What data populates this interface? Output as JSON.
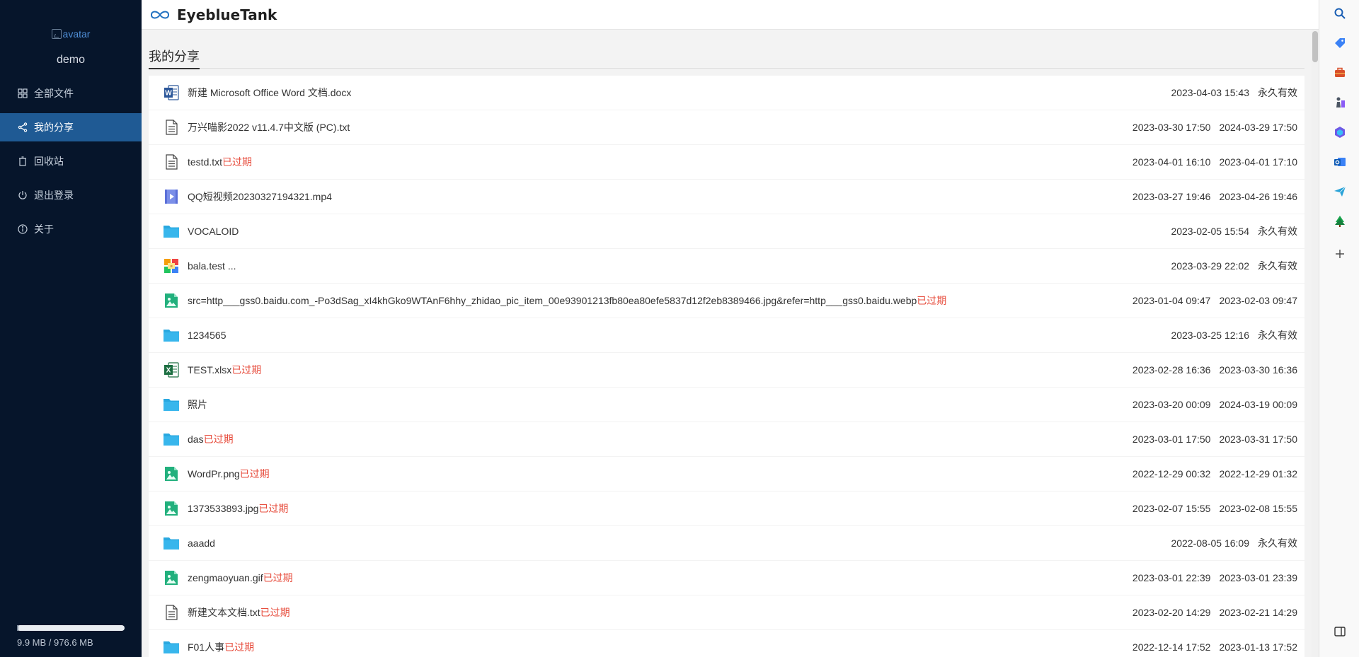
{
  "app": {
    "brand": "EyeblueTank"
  },
  "user": {
    "avatar_alt": "avatar",
    "name": "demo"
  },
  "sidebar": {
    "items": [
      {
        "label": "全部文件",
        "icon": "grid-icon"
      },
      {
        "label": "我的分享",
        "icon": "share-icon",
        "active": true
      },
      {
        "label": "回收站",
        "icon": "trash-icon"
      },
      {
        "label": "退出登录",
        "icon": "power-icon"
      },
      {
        "label": "关于",
        "icon": "info-icon"
      }
    ],
    "storage": {
      "text": "9.9 MB / 976.6 MB",
      "fraction": 0.0101
    }
  },
  "page": {
    "title": "我的分享"
  },
  "shares": [
    {
      "name": "新建 Microsoft Office Word 文档.docx",
      "type": "word",
      "expired": "",
      "created": "2023-04-03 15:43",
      "expire": "永久有效"
    },
    {
      "name": "万兴喵影2022 v11.4.7中文版 (PC).txt",
      "type": "text",
      "expired": "",
      "created": "2023-03-30 17:50",
      "expire": "2024-03-29 17:50"
    },
    {
      "name": "testd.txt",
      "type": "text",
      "expired": "已过期",
      "created": "2023-04-01 16:10",
      "expire": "2023-04-01 17:10"
    },
    {
      "name": "QQ短视频20230327194321.mp4",
      "type": "video",
      "expired": "",
      "created": "2023-03-27 19:46",
      "expire": "2023-04-26 19:46"
    },
    {
      "name": "VOCALOID",
      "type": "folder",
      "expired": "",
      "created": "2023-02-05 15:54",
      "expire": "永久有效"
    },
    {
      "name": "bala.test ...",
      "type": "multi",
      "expired": "",
      "created": "2023-03-29 22:02",
      "expire": "永久有效"
    },
    {
      "name": "src=http___gss0.baidu.com_-Po3dSag_xI4khGko9WTAnF6hhy_zhidao_pic_item_00e93901213fb80ea80efe5837d12f2eb8389466.jpg&refer=http___gss0.baidu.webp",
      "type": "image",
      "expired": "已过期",
      "created": "2023-01-04 09:47",
      "expire": "2023-02-03 09:47"
    },
    {
      "name": "1234565",
      "type": "folder",
      "expired": "",
      "created": "2023-03-25 12:16",
      "expire": "永久有效"
    },
    {
      "name": "TEST.xlsx",
      "type": "excel",
      "expired": "已过期",
      "created": "2023-02-28 16:36",
      "expire": "2023-03-30 16:36"
    },
    {
      "name": "照片",
      "type": "folder",
      "expired": "",
      "created": "2023-03-20 00:09",
      "expire": "2024-03-19 00:09"
    },
    {
      "name": "das",
      "type": "folder",
      "expired": "已过期",
      "created": "2023-03-01 17:50",
      "expire": "2023-03-31 17:50"
    },
    {
      "name": "WordPr.png",
      "type": "image",
      "expired": "已过期",
      "created": "2022-12-29 00:32",
      "expire": "2022-12-29 01:32"
    },
    {
      "name": "1373533893.jpg",
      "type": "image",
      "expired": "已过期",
      "created": "2023-02-07 15:55",
      "expire": "2023-02-08 15:55"
    },
    {
      "name": "aaadd",
      "type": "folder",
      "expired": "",
      "created": "2022-08-05 16:09",
      "expire": "永久有效"
    },
    {
      "name": "zengmaoyuan.gif",
      "type": "image",
      "expired": "已过期",
      "created": "2023-03-01 22:39",
      "expire": "2023-03-01 23:39"
    },
    {
      "name": "新建文本文档.txt",
      "type": "text",
      "expired": "已过期",
      "created": "2023-02-20 14:29",
      "expire": "2023-02-21 14:29"
    },
    {
      "name": "F01人事",
      "type": "folder",
      "expired": "已过期",
      "created": "2022-12-14 17:52",
      "expire": "2023-01-13 17:52"
    }
  ],
  "rightbar": {
    "icons": [
      "search-icon",
      "tag-icon",
      "briefcase-icon",
      "chess-icon",
      "copilot-icon",
      "outlook-icon",
      "send-icon",
      "tree-icon",
      "plus-icon",
      "sidebar-toggle-icon"
    ]
  },
  "colors": {
    "sidebar_bg": "#06152b",
    "active_item": "#1f5a94",
    "expired_text": "#e74c3c",
    "folder": "#29a8e0"
  }
}
